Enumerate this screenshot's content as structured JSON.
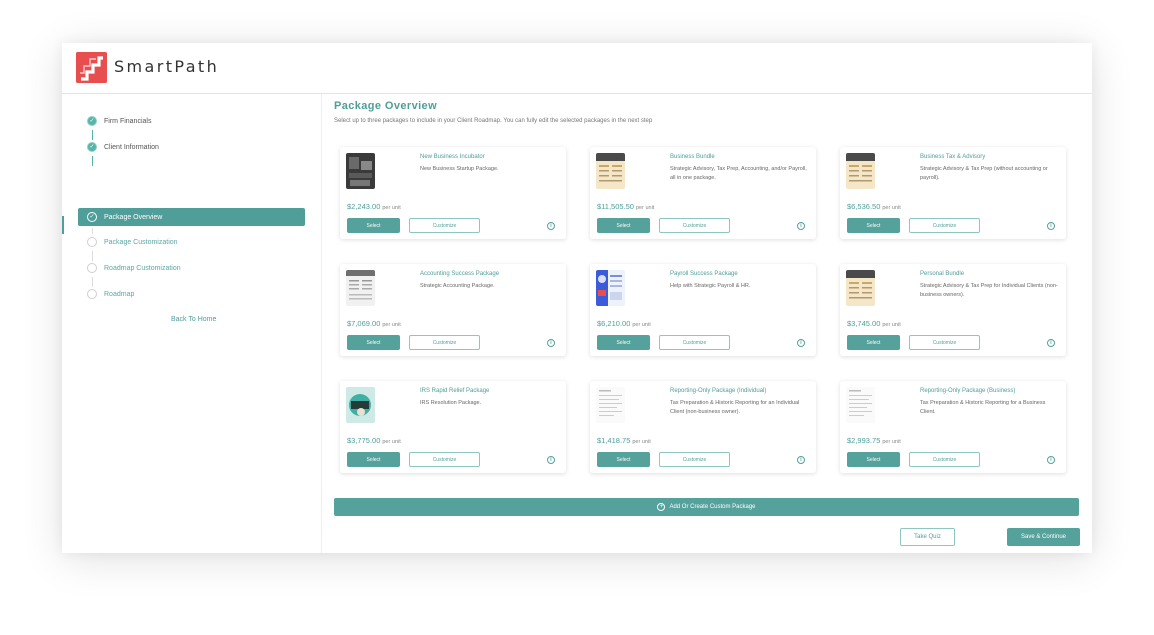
{
  "brand": {
    "name": "SmartPath",
    "color": "#e94e4e",
    "accent": "#55a19b"
  },
  "sidebar": {
    "steps": [
      {
        "label": "Firm Financials",
        "state": "done"
      },
      {
        "label": "Client Information",
        "state": "done"
      },
      {
        "label": "Package Overview",
        "state": "active"
      },
      {
        "label": "Package Customization",
        "state": "todo"
      },
      {
        "label": "Roadmap Customization",
        "state": "todo"
      },
      {
        "label": "Roadmap",
        "state": "todo"
      }
    ],
    "back_home": "Back To Home"
  },
  "main": {
    "title": "Package Overview",
    "subtitle": "Select up to three packages to include in your Client Roadmap. You can fully edit the selected packages in the next step",
    "select_label": "Select",
    "customize_label": "Customize",
    "per_unit": "per unit",
    "packages": [
      {
        "title": "New Business Incubator",
        "desc": "New Business Startup Package.",
        "price": "$2,243.00",
        "thumb": "dark-photo"
      },
      {
        "title": "Business Bundle",
        "desc": "Strategic Advisory, Tax Prep, Accounting, and/or Payroll, all in one package.",
        "price": "$11,505.50",
        "thumb": "doc-tan"
      },
      {
        "title": "Business Tax & Advisory",
        "desc": "Strategic Advisory & Tax Prep (without accounting or payroll).",
        "price": "$6,536.50",
        "thumb": "doc-tan"
      },
      {
        "title": "Accounting Success Package",
        "desc": "Strategic Accounting Package.",
        "price": "$7,069.00",
        "thumb": "doc-grey"
      },
      {
        "title": "Payroll Success Package",
        "desc": "Help with Strategic Payroll & HR.",
        "price": "$6,210.00",
        "thumb": "doc-blue"
      },
      {
        "title": "Personal Bundle",
        "desc": "Strategic Advisory & Tax Prep for Individual Clients (non-business owners).",
        "price": "$3,745.00",
        "thumb": "doc-tan"
      },
      {
        "title": "IRS Rapid Relief Package",
        "desc": "IRS Resolution Package.",
        "price": "$3,775.00",
        "thumb": "teal-photo"
      },
      {
        "title": "Reporting-Only Package (Individual)",
        "desc": "Tax Preparation & Historic Reporting for an Individual Client (non-business owner).",
        "price": "$1,418.75",
        "thumb": "doc-white"
      },
      {
        "title": "Reporting-Only Package (Business)",
        "desc": "Tax Preparation & Historic Reporting for a Business Client.",
        "price": "$2,993.75",
        "thumb": "doc-white"
      }
    ],
    "add_custom": "Add Or Create Custom Package",
    "take_quiz": "Take Quiz",
    "save_continue": "Save & Continue"
  }
}
